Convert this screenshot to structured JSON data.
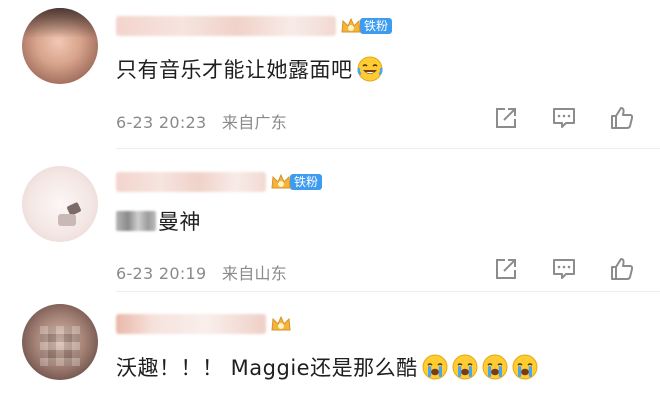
{
  "colors": {
    "fan_badge": "#3d9bf0",
    "crown": "#f2b53a",
    "meta_text": "#8a8a8a",
    "action_icon": "#8c8c8c"
  },
  "comments": [
    {
      "user_name": "",
      "fan_badge": "铁粉",
      "text": "只有音乐才能让她露面吧",
      "emoji": "laughing-tears",
      "date": "6-23 20:23",
      "location": "来自广东"
    },
    {
      "user_name": "",
      "fan_badge": "铁粉",
      "text": "曼神",
      "emoji": "",
      "date": "6-23 20:19",
      "location": "来自山东"
    },
    {
      "user_name": "",
      "fan_badge": "",
      "text": "沃趣！！！ Maggie还是那么酷",
      "emoji": "crying-face",
      "emoji_count": 4,
      "date": "",
      "location": ""
    }
  ],
  "actions": [
    "share-icon",
    "comment-icon",
    "like-icon"
  ]
}
